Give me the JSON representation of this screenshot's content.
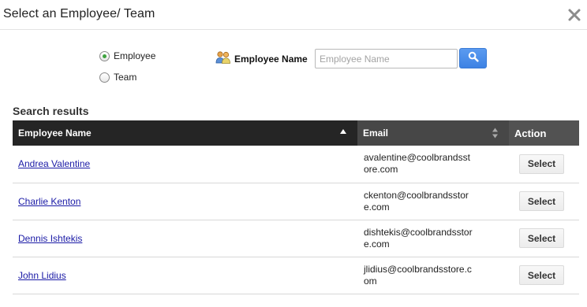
{
  "dialog": {
    "title": "Select an Employee/ Team",
    "close_icon": "close-icon"
  },
  "filter": {
    "options": [
      {
        "label": "Employee",
        "selected": true
      },
      {
        "label": "Team",
        "selected": false
      }
    ],
    "field_label": "Employee Name",
    "field_icon": "people-icon",
    "search_placeholder": "Employee Name",
    "search_value": "",
    "search_icon": "search-icon"
  },
  "results": {
    "heading": "Search results",
    "columns": {
      "name": "Employee Name",
      "email": "Email",
      "action": "Action"
    },
    "rows": [
      {
        "name": "Andrea Valentine",
        "email_line1": "avalentine@coolbrandsst",
        "email_line2": "ore.com",
        "action": "Select"
      },
      {
        "name": "Charlie Kenton",
        "email_line1": "ckenton@coolbrandsstor",
        "email_line2": "e.com",
        "action": "Select"
      },
      {
        "name": "Dennis Ishtekis",
        "email_line1": "dishtekis@coolbrandsstor",
        "email_line2": "e.com",
        "action": "Select"
      },
      {
        "name": "John Lidius",
        "email_line1": "jlidius@coolbrandsstore.c",
        "email_line2": "om",
        "action": "Select"
      }
    ]
  },
  "colors": {
    "accent": "#3d82e4",
    "header_dark": "#252525",
    "link": "#1a1aa6",
    "radio_selected": "#3fa33f"
  }
}
